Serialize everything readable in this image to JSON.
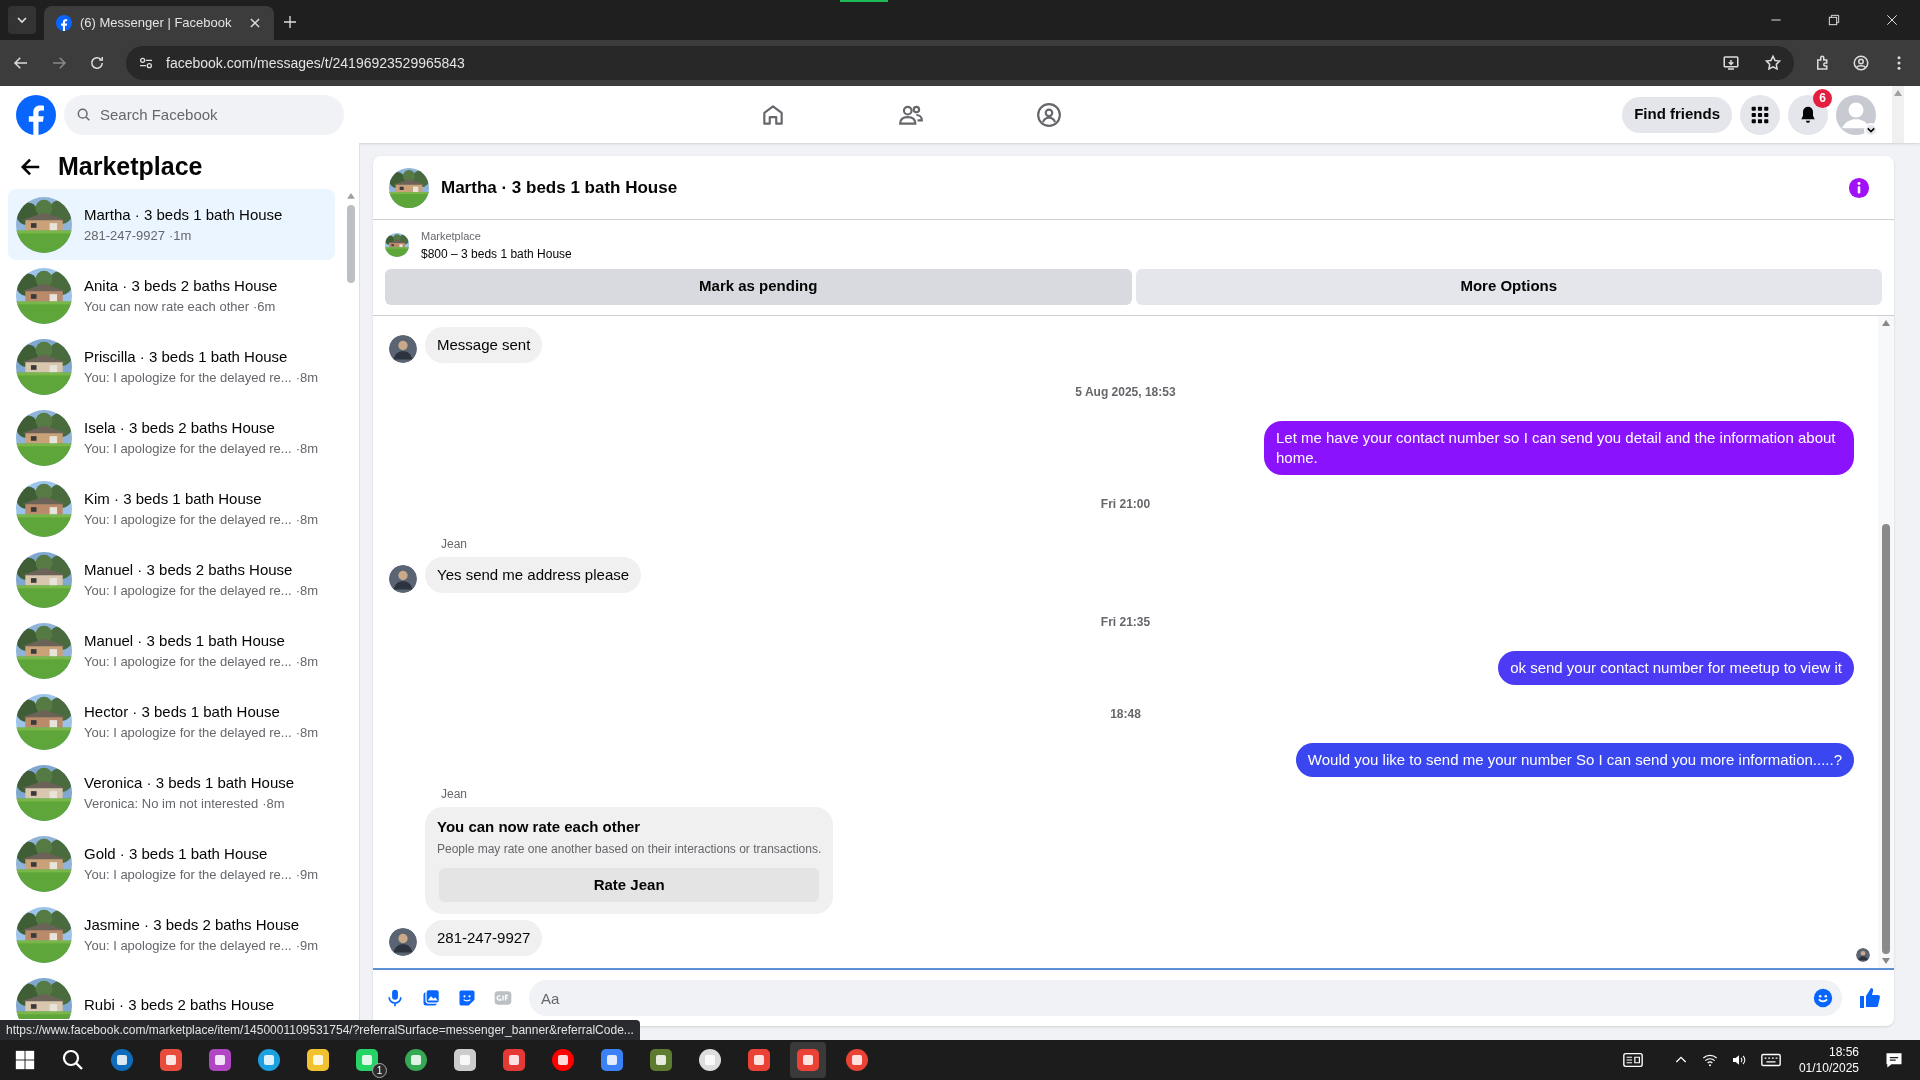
{
  "browser": {
    "tab_title": "(6) Messenger | Facebook",
    "url": "facebook.com/messages/t/24196923529965843",
    "status_url": "https://www.facebook.com/marketplace/item/1450001109531754/?referralSurface=messenger_banner&referralCode..."
  },
  "header": {
    "search_placeholder": "Search Facebook",
    "find_friends": "Find friends",
    "notification_count": "6"
  },
  "sidebar": {
    "title": "Marketplace",
    "items": [
      {
        "title": "Martha · 3 beds 1 bath House",
        "preview": "281-247-9927",
        "time": "·1m",
        "selected": true
      },
      {
        "title": "Anita · 3 beds 2 baths House",
        "preview": "You can now rate each other",
        "time": "·6m",
        "selected": false
      },
      {
        "title": "Priscilla · 3 beds 1 bath House",
        "preview": "You: I apologize for the delayed re...",
        "time": "·8m",
        "selected": false
      },
      {
        "title": "Isela · 3 beds 2 baths House",
        "preview": "You: I apologize for the delayed re...",
        "time": "·8m",
        "selected": false
      },
      {
        "title": "Kim · 3 beds 1 bath House",
        "preview": "You: I apologize for the delayed re...",
        "time": "·8m",
        "selected": false
      },
      {
        "title": "Manuel · 3 beds 2 baths House",
        "preview": "You: I apologize for the delayed re...",
        "time": "·8m",
        "selected": false
      },
      {
        "title": "Manuel · 3 beds 1 bath House",
        "preview": "You: I apologize for the delayed re...",
        "time": "·8m",
        "selected": false
      },
      {
        "title": "Hector · 3 beds 1 bath House",
        "preview": "You: I apologize for the delayed re...",
        "time": "·8m",
        "selected": false
      },
      {
        "title": "Veronica · 3 beds 1 bath House",
        "preview": "Veronica: No im not interested",
        "time": "·8m",
        "selected": false
      },
      {
        "title": "Gold · 3 beds 1 bath House",
        "preview": "You: I apologize for the delayed re...",
        "time": "·9m",
        "selected": false
      },
      {
        "title": "Jasmine · 3 beds 2 baths House",
        "preview": "You: I apologize for the delayed re...",
        "time": "·9m",
        "selected": false
      },
      {
        "title": "Rubi · 3 beds 2 baths House",
        "selected": false
      }
    ]
  },
  "chat": {
    "title": "Martha · 3 beds 1 bath House",
    "listing": {
      "label": "Marketplace",
      "text": "$800 – 3 beds 1 bath House"
    },
    "buttons": [
      {
        "label": "Mark as pending",
        "hovered": true
      },
      {
        "label": "More Options",
        "hovered": false
      }
    ],
    "messages": [
      {
        "kind": "incoming",
        "text": "Message sent",
        "avatar": true
      },
      {
        "kind": "timestamp",
        "text": "5 Aug 2025, 18:53"
      },
      {
        "kind": "outgoing",
        "text": "Let me have your contact number so I can send you detail and the information about home.",
        "color": "#8a12fc"
      },
      {
        "kind": "timestamp",
        "text": "Fri 21:00"
      },
      {
        "kind": "incoming",
        "sender": "Jean",
        "text": "Yes send me address please",
        "avatar": true
      },
      {
        "kind": "timestamp",
        "text": "Fri 21:35"
      },
      {
        "kind": "outgoing",
        "text": "ok send your contact number for meetup to view it",
        "color": "#4d3af4"
      },
      {
        "kind": "timestamp",
        "text": "18:48"
      },
      {
        "kind": "outgoing",
        "text": "Would you like to send me your number So I can send you more information.....?",
        "color": "#3a46f0"
      },
      {
        "kind": "rating_card",
        "sender": "Jean",
        "title": "You can now rate each other",
        "body": "People may rate one another based on their interactions or transactions.",
        "button": "Rate Jean"
      },
      {
        "kind": "incoming",
        "text": "281-247-9927",
        "avatar": true
      }
    ],
    "composer": {
      "placeholder": "Aa"
    }
  },
  "taskbar": {
    "whatsapp_badge": "1",
    "time": "18:56",
    "date": "01/10/2025"
  }
}
